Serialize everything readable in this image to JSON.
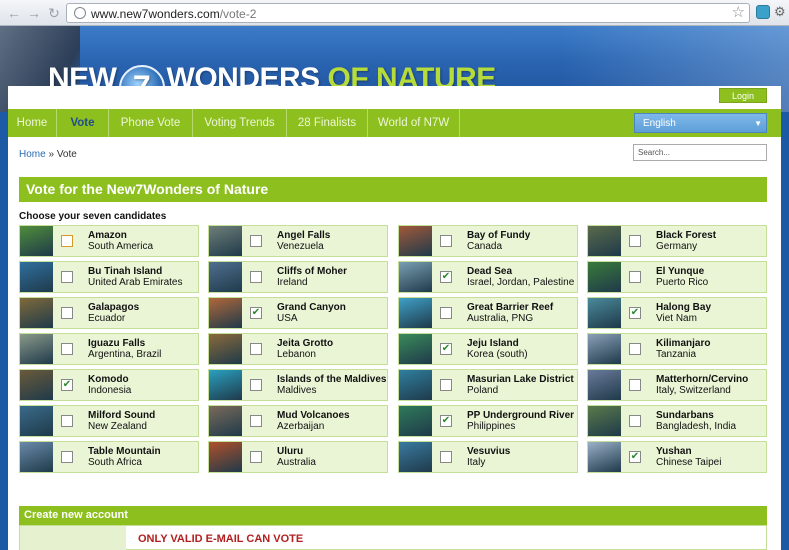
{
  "browser": {
    "url_host": "www.new7wonders.com",
    "url_path": "/vote-2"
  },
  "header": {
    "logo_new": "NEW",
    "logo_seven": "7",
    "logo_wonders": "WONDERS",
    "logo_of_nature": "OF NATURE",
    "login": "Login"
  },
  "menu": {
    "items": [
      "Home",
      "Vote",
      "Phone Vote",
      "Voting Trends",
      "28 Finalists",
      "World of N7W"
    ],
    "active": "Vote",
    "language": "English"
  },
  "breadcrumb": {
    "home": "Home",
    "sep": "»",
    "current": "Vote"
  },
  "search": {
    "placeholder": "Search..."
  },
  "vote": {
    "title": "Vote for the New7Wonders of Nature",
    "instruction": "Choose your seven candidates"
  },
  "candidates": [
    {
      "name": "Amazon",
      "country": "South America",
      "checked": false,
      "thumb": "#4f8d3a"
    },
    {
      "name": "Angel Falls",
      "country": "Venezuela",
      "checked": false,
      "thumb": "#6f7f78"
    },
    {
      "name": "Bay of Fundy",
      "country": "Canada",
      "checked": false,
      "thumb": "#a0593a"
    },
    {
      "name": "Black Forest",
      "country": "Germany",
      "checked": false,
      "thumb": "#5a6a4a"
    },
    {
      "name": "Bu Tinah Island",
      "country": "United Arab Emirates",
      "checked": false,
      "thumb": "#2f6f9f"
    },
    {
      "name": "Cliffs of Moher",
      "country": "Ireland",
      "checked": false,
      "thumb": "#4f6f8f"
    },
    {
      "name": "Dead Sea",
      "country": "Israel, Jordan, Palestine",
      "checked": true,
      "thumb": "#7a9fb2"
    },
    {
      "name": "El Yunque",
      "country": "Puerto Rico",
      "checked": false,
      "thumb": "#3a7a3a"
    },
    {
      "name": "Galapagos",
      "country": "Ecuador",
      "checked": false,
      "thumb": "#7f6a3a"
    },
    {
      "name": "Grand Canyon",
      "country": "USA",
      "checked": true,
      "thumb": "#b0683a"
    },
    {
      "name": "Great Barrier Reef",
      "country": "Australia, PNG",
      "checked": false,
      "thumb": "#3fa0c8"
    },
    {
      "name": "Halong Bay",
      "country": "Viet Nam",
      "checked": true,
      "thumb": "#4a8a9a"
    },
    {
      "name": "Iguazu Falls",
      "country": "Argentina, Brazil",
      "checked": false,
      "thumb": "#8a9a8a"
    },
    {
      "name": "Jeita Grotto",
      "country": "Lebanon",
      "checked": false,
      "thumb": "#8a6a3a"
    },
    {
      "name": "Jeju Island",
      "country": "Korea (south)",
      "checked": true,
      "thumb": "#3a8a5a"
    },
    {
      "name": "Kilimanjaro",
      "country": "Tanzania",
      "checked": false,
      "thumb": "#8aa0b8"
    },
    {
      "name": "Komodo",
      "country": "Indonesia",
      "checked": true,
      "thumb": "#6a5a3a"
    },
    {
      "name": "Islands of the Maldives",
      "country": "Maldives",
      "checked": false,
      "thumb": "#2aa0c0"
    },
    {
      "name": "Masurian Lake District",
      "country": "Poland",
      "checked": false,
      "thumb": "#2f7f9f"
    },
    {
      "name": "Matterhorn/Cervino",
      "country": "Italy, Switzerland",
      "checked": false,
      "thumb": "#6a7a9a"
    },
    {
      "name": "Milford Sound",
      "country": "New Zealand",
      "checked": false,
      "thumb": "#3a6a8a"
    },
    {
      "name": "Mud Volcanoes",
      "country": "Azerbaijan",
      "checked": false,
      "thumb": "#7a6a5a"
    },
    {
      "name": "PP Underground River",
      "country": "Philippines",
      "checked": true,
      "thumb": "#2f7a5a"
    },
    {
      "name": "Sundarbans",
      "country": "Bangladesh, India",
      "checked": false,
      "thumb": "#5a7a4a"
    },
    {
      "name": "Table Mountain",
      "country": "South Africa",
      "checked": false,
      "thumb": "#6a8aaa"
    },
    {
      "name": "Uluru",
      "country": "Australia",
      "checked": false,
      "thumb": "#b0502a"
    },
    {
      "name": "Vesuvius",
      "country": "Italy",
      "checked": false,
      "thumb": "#3a7aa0"
    },
    {
      "name": "Yushan",
      "country": "Chinese Taipei",
      "checked": true,
      "thumb": "#9ab0c8"
    }
  ],
  "account": {
    "title": "Create new account",
    "notice": "ONLY VALID E-MAIL CAN VOTE"
  },
  "colors": {
    "accent": "#8dc01f",
    "link": "#2a6cb3",
    "banner": "#2a65b2",
    "notice": "#b21f1f"
  }
}
